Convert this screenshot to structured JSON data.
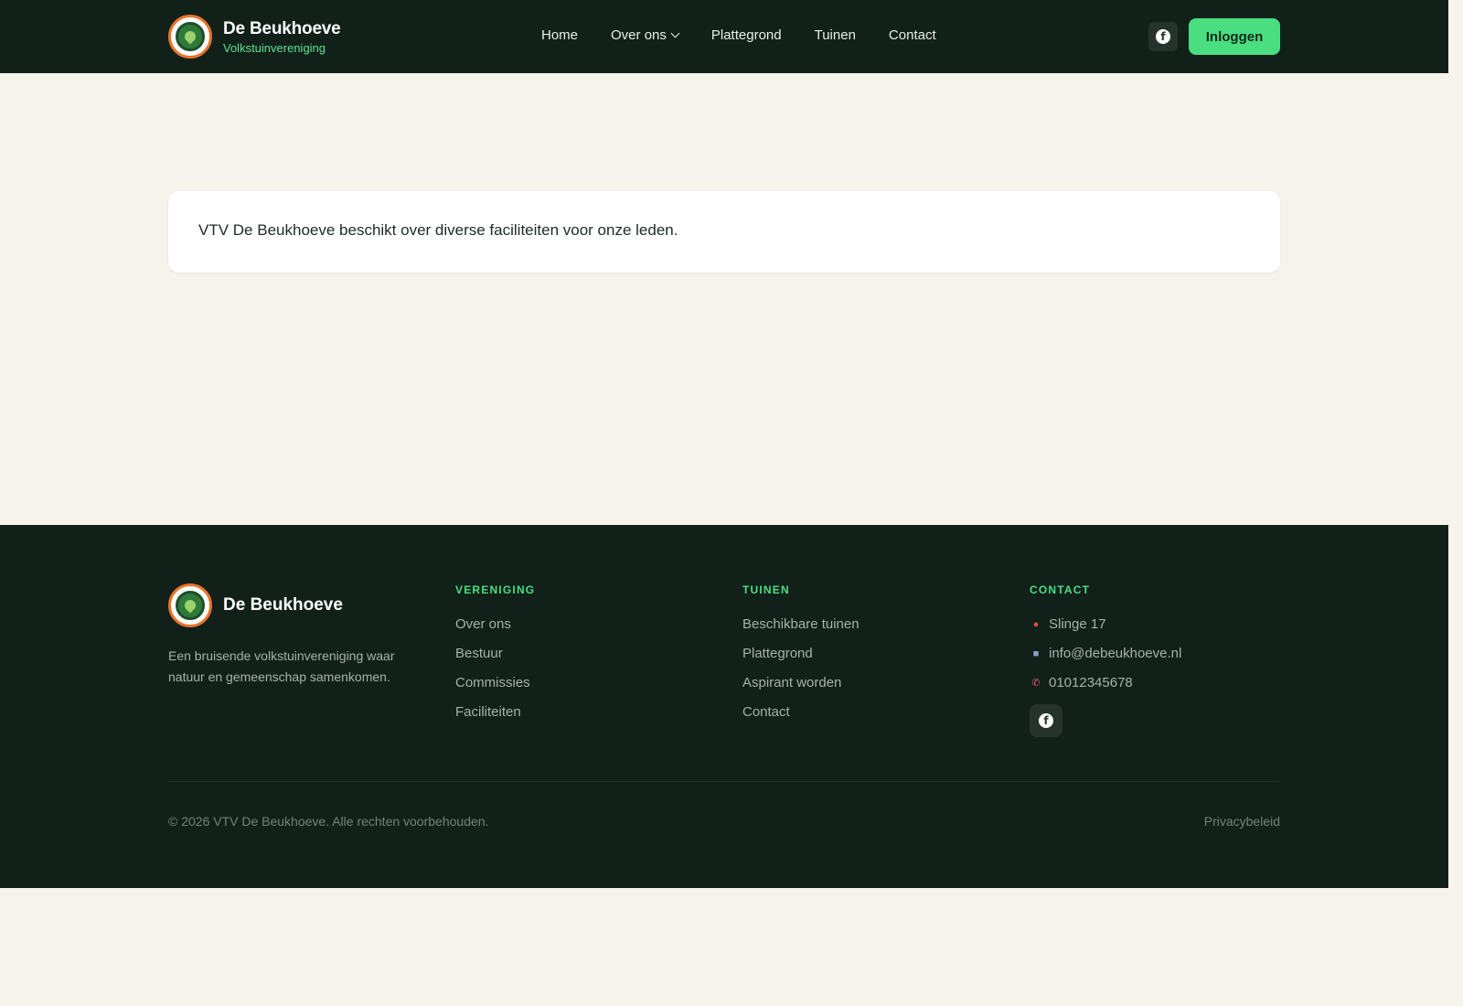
{
  "header": {
    "brand_title": "De Beukhoeve",
    "brand_subtitle": "Volkstuinvereniging",
    "nav": [
      {
        "label": "Home"
      },
      {
        "label": "Over ons",
        "has_dropdown": true
      },
      {
        "label": "Plattegrond"
      },
      {
        "label": "Tuinen"
      },
      {
        "label": "Contact"
      }
    ],
    "social_icon": "facebook-icon",
    "login_label": "Inloggen"
  },
  "main": {
    "intro_text": "VTV De Beukhoeve beschikt over diverse faciliteiten voor onze leden."
  },
  "footer": {
    "brand": "De Beukhoeve",
    "description": "Een bruisende volkstuinvereniging waar natuur en gemeenschap samenkomen.",
    "columns": {
      "vereniging": {
        "heading": "VERENIGING",
        "links": [
          "Over ons",
          "Bestuur",
          "Commissies",
          "Faciliteiten"
        ]
      },
      "tuinen": {
        "heading": "TUINEN",
        "links": [
          "Beschikbare tuinen",
          "Plattegrond",
          "Aspirant worden",
          "Contact"
        ]
      },
      "contact": {
        "heading": "CONTACT",
        "address": "Slinge 17",
        "email": "info@debeukhoeve.nl",
        "phone": "01012345678"
      }
    },
    "copyright": "© 2026 VTV De Beukhoeve. Alle rechten voorbehouden.",
    "privacy": "Privacybeleid"
  },
  "colors": {
    "dark_green": "#12201a",
    "accent_green": "#4ade80",
    "background": "#f6f3ec",
    "logo_ring": "#e8742a"
  }
}
